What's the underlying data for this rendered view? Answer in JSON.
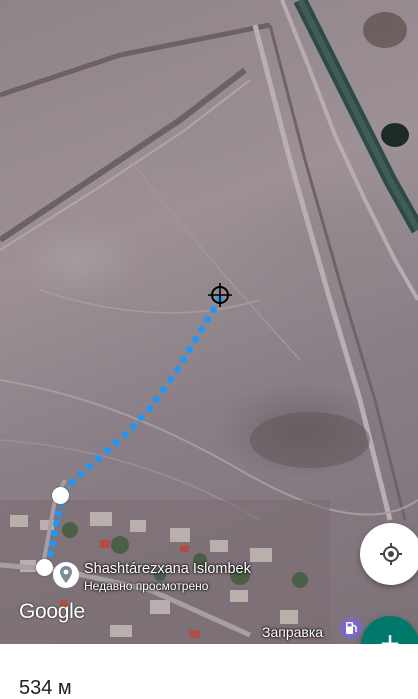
{
  "map": {
    "place_name": "Shashtárezxana Islombek",
    "place_subtitle": "Недавно просмотрено",
    "poi_label": "Заправка",
    "logo": "Google",
    "route_color": "#2196f3",
    "pin_icon": "location-pin-icon",
    "poi_icon": "gas-station-icon"
  },
  "controls": {
    "locate_icon": "my-location-icon",
    "add_label": "+",
    "fab_color": "#00796b"
  },
  "measurement": {
    "distance": "534 м"
  }
}
